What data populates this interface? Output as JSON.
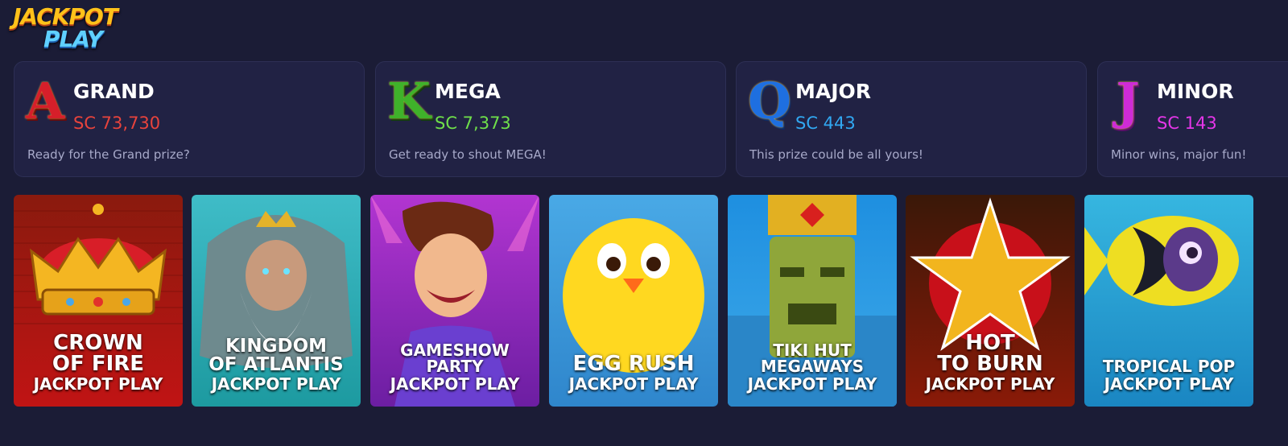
{
  "logo": {
    "line1": "JACKPOT",
    "line2": "PLAY"
  },
  "jackpots": [
    {
      "letter": "A",
      "name": "GRAND",
      "amount": "SC 73,730",
      "description": "Ready for the Grand prize?",
      "color": "#e8433c",
      "letter_color": "#d61f2a"
    },
    {
      "letter": "K",
      "name": "MEGA",
      "amount": "SC 7,373",
      "description": "Get ready to shout MEGA!",
      "color": "#6fe04a",
      "letter_color": "#3fb22a"
    },
    {
      "letter": "Q",
      "name": "MAJOR",
      "amount": "SC 443",
      "description": "This prize could be all yours!",
      "color": "#31a8f2",
      "letter_color": "#1e6fe0"
    },
    {
      "letter": "J",
      "name": "MINOR",
      "amount": "SC 143",
      "description": "Minor wins, major fun!",
      "color": "#e536e8",
      "letter_color": "#cf2bd6"
    }
  ],
  "games": [
    {
      "title_line1": "CROWN",
      "title_line2": "OF FIRE",
      "subtitle": "JACKPOT PLAY",
      "icon": "crown-icon"
    },
    {
      "title_line1": "KINGDOM",
      "title_line2": "OF ATLANTIS",
      "subtitle": "JACKPOT PLAY",
      "icon": "poseidon-icon"
    },
    {
      "title_line1": "GAMESHOW",
      "title_line2": "PARTY",
      "subtitle": "JACKPOT PLAY",
      "icon": "host-icon"
    },
    {
      "title_line1": "EGG RUSH",
      "title_line2": "",
      "subtitle": "JACKPOT PLAY",
      "icon": "chick-icon"
    },
    {
      "title_line1": "TIKI HUT",
      "title_line2": "MEGAWAYS",
      "subtitle": "JACKPOT PLAY",
      "icon": "tiki-icon"
    },
    {
      "title_line1": "HOT",
      "title_line2": "TO BURN",
      "subtitle": "JACKPOT PLAY",
      "icon": "star-icon"
    },
    {
      "title_line1": "TROPICAL POP",
      "title_line2": "",
      "subtitle": "JACKPOT PLAY",
      "icon": "fish-icon"
    }
  ]
}
